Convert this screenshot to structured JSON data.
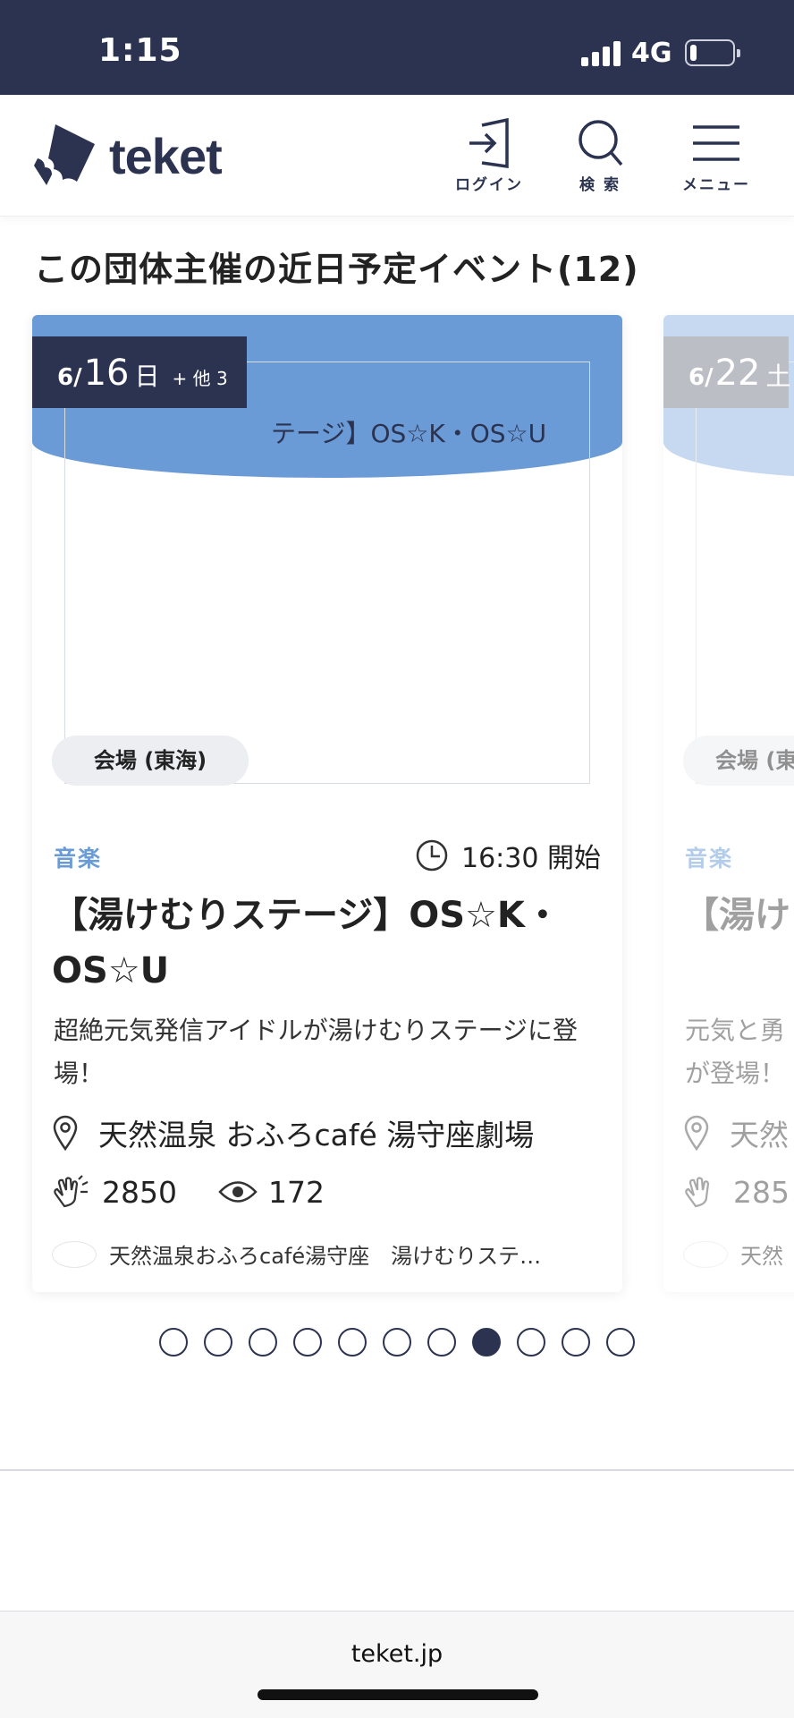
{
  "status_bar": {
    "time": "1:15",
    "network": "4G",
    "battery_level": 0.15
  },
  "header": {
    "logo_text": "teket",
    "nav": {
      "login": "ログイン",
      "search": "検 索",
      "menu": "メニュー"
    }
  },
  "section": {
    "title": "この団体主催の近日予定イベント(12)"
  },
  "card": {
    "thumb_text": "テージ】OS☆K・OS☆U",
    "date": {
      "month": "6/",
      "day": "16",
      "weekday": "日",
      "more": "+ 他 3"
    },
    "venue_chip": "会場 (東海)",
    "category": "音楽",
    "start_time": "16:30 開始",
    "title": "【湯けむりステージ】OS☆K・OS☆U",
    "description": "超絶元気発信アイドルが湯けむりステージに登場！",
    "place": "天然温泉 おふろcafé 湯守座劇場",
    "claps": "2850",
    "views": "172",
    "organizer": "天然温泉おふろcafé湯守座　湯けむりステ…"
  },
  "next_card": {
    "date": {
      "month": "6/",
      "day": "22",
      "weekday": "土"
    },
    "venue_chip": "会場 (東",
    "category": "音楽",
    "title": "【湯け",
    "description": "元気と勇が登場！",
    "place": "天然",
    "claps": "285",
    "organizer": "天然"
  },
  "pager": {
    "count": 11,
    "active_index": 7
  },
  "browser": {
    "url": "teket.jp"
  },
  "colors": {
    "navy": "#2c3350",
    "accent_blue": "#6a9bd6"
  }
}
